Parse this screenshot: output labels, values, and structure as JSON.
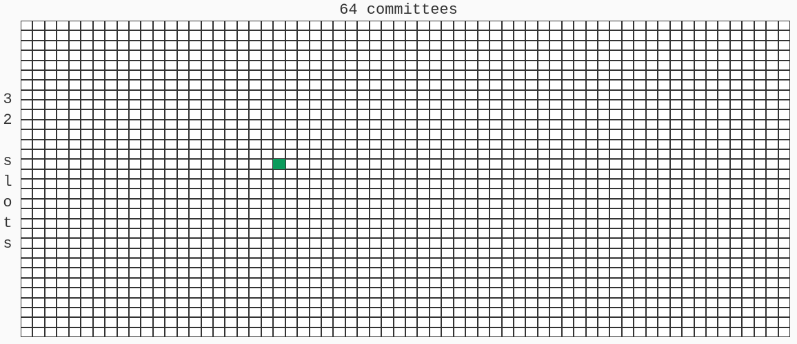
{
  "chart_data": {
    "type": "heatmap",
    "title": "64 committees",
    "xlabel": "",
    "ylabel": "32 slots",
    "cols": 64,
    "rows": 32,
    "highlighted_cells": [
      {
        "row": 14,
        "col": 21
      }
    ],
    "highlight_color": "#0a9b5b",
    "cell_color": "#ffffff",
    "border_color": "#333333"
  }
}
